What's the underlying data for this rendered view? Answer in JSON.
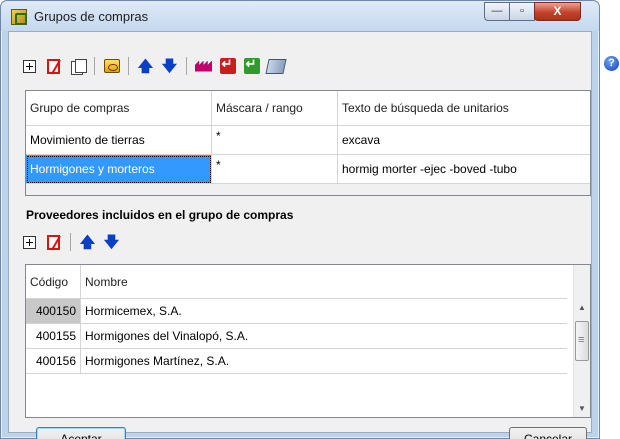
{
  "window": {
    "title": "Grupos de compras",
    "controls": {
      "minimize": "—",
      "maximize": "▫",
      "close": "X"
    }
  },
  "toolbar_main": {
    "icons": [
      "add-icon",
      "delete-icon",
      "copy-icon",
      "print-icon",
      "move-up-icon",
      "move-down-icon",
      "factory-icon",
      "import-icon",
      "export-icon",
      "book-icon"
    ]
  },
  "help_label": "?",
  "groups_table": {
    "columns": [
      "Grupo de compras",
      "Máscara / rango",
      "Texto de búsqueda de unitarios"
    ],
    "rows": [
      {
        "group": "Movimiento de tierras",
        "mask": "*",
        "search": "excava"
      },
      {
        "group": "Hormigones y morteros",
        "mask": "*",
        "search": "hormig morter -ejec -boved -tubo"
      }
    ]
  },
  "suppliers_section_title": "Proveedores incluidos en el grupo de compras",
  "suppliers_table": {
    "columns": [
      "Código",
      "Nombre"
    ],
    "rows": [
      {
        "code": "400150",
        "name": "Hormicemex, S.A."
      },
      {
        "code": "400155",
        "name": "Hormigones del Vinalopó, S.A."
      },
      {
        "code": "400156",
        "name": "Hormigones Martínez, S.A."
      }
    ]
  },
  "buttons": {
    "accept": "Aceptar",
    "cancel": "Cancelar"
  }
}
